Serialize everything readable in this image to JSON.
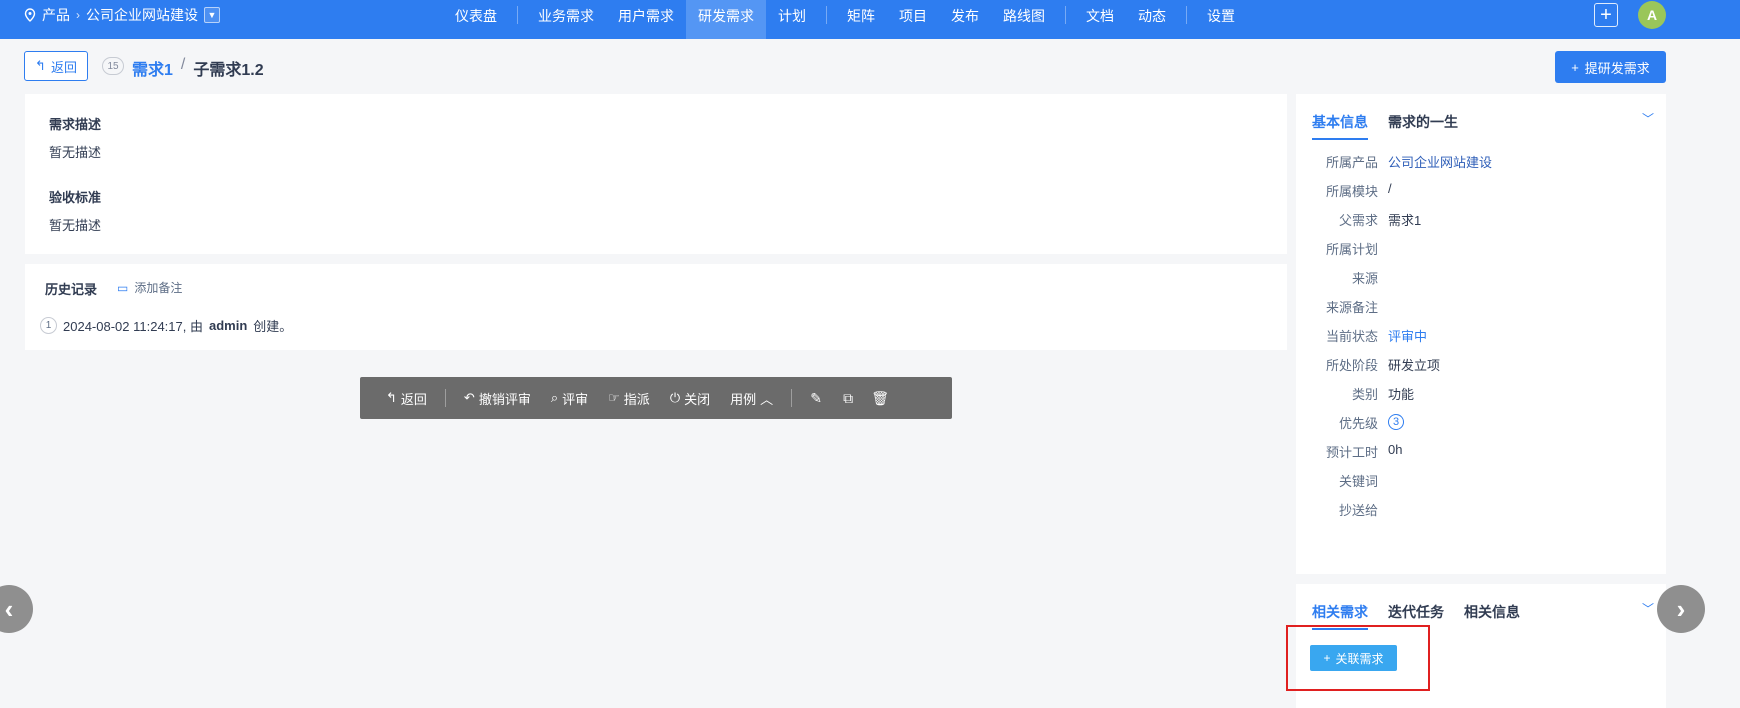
{
  "topbar": {
    "product_label": "产品",
    "product_name": "公司企业网站建设",
    "nav": [
      "仪表盘",
      "业务需求",
      "用户需求",
      "研发需求",
      "计划",
      "矩阵",
      "项目",
      "发布",
      "路线图",
      "文档",
      "动态",
      "设置"
    ],
    "active_nav": "研发需求",
    "avatar_letter": "A"
  },
  "header": {
    "back_label": "返回",
    "id": "15",
    "parent_title": "需求1",
    "separator": "/",
    "title": "子需求1.2",
    "create_label": "提研发需求"
  },
  "main": {
    "desc_title": "需求描述",
    "desc_text": "暂无描述",
    "accept_title": "验收标准",
    "accept_text": "暂无描述"
  },
  "history": {
    "title": "历史记录",
    "add_note": "添加备注",
    "entry_num": "1",
    "entry_time": "2024-08-02 11:24:17, 由",
    "entry_user": "admin",
    "entry_action": "创建。"
  },
  "toolbar": {
    "back": "返回",
    "undo_review": "撤销评审",
    "review": "评审",
    "assign": "指派",
    "close": "关闭",
    "cases": "用例"
  },
  "info": {
    "tabs": [
      "基本信息",
      "需求的一生"
    ],
    "rows": [
      {
        "label": "所属产品",
        "value": "公司企业网站建设"
      },
      {
        "label": "所属模块",
        "value": "/"
      },
      {
        "label": "父需求",
        "value": "需求1"
      },
      {
        "label": "所属计划",
        "value": ""
      },
      {
        "label": "来源",
        "value": ""
      },
      {
        "label": "来源备注",
        "value": ""
      },
      {
        "label": "当前状态",
        "value": "评审中"
      },
      {
        "label": "所处阶段",
        "value": "研发立项"
      },
      {
        "label": "类别",
        "value": "功能"
      },
      {
        "label": "优先级",
        "value": "3"
      },
      {
        "label": "预计工时",
        "value": "0h"
      },
      {
        "label": "关键词",
        "value": ""
      },
      {
        "label": "抄送给",
        "value": ""
      }
    ]
  },
  "related": {
    "tabs": [
      "相关需求",
      "迭代任务",
      "相关信息"
    ],
    "link_label": "关联需求"
  },
  "colors": {
    "primary": "#2e7df0",
    "toolbar": "#6b6b6b",
    "highlight": "#e02020"
  }
}
